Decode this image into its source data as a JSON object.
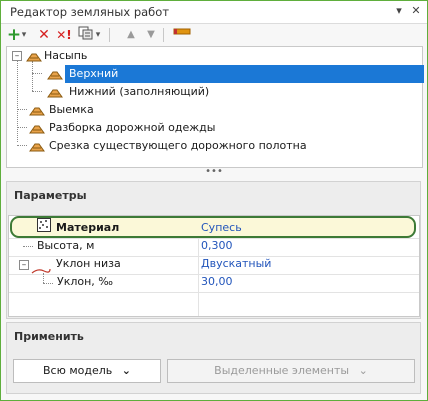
{
  "window": {
    "title": "Редактор земляных работ",
    "accent": "#5fae3c"
  },
  "titlebar": {
    "pin_glyph": "▾",
    "close_glyph": "✕"
  },
  "toolbar": {
    "add_glyph": "+",
    "dropdown_glyph": "▾",
    "delete_glyph": "✕",
    "delete_all_glyph": "✕!",
    "up_glyph": "▲",
    "down_glyph": "▼"
  },
  "tree": {
    "expander_glyph": "–",
    "items": [
      {
        "label": "Насыпь"
      },
      {
        "label": "Верхний"
      },
      {
        "label": "Нижний (заполняющий)"
      },
      {
        "label": "Выемка"
      },
      {
        "label": "Разборка дорожной одежды"
      },
      {
        "label": "Срезка существующего дорожного полотна"
      }
    ]
  },
  "splitter": {
    "glyph": "•••"
  },
  "params": {
    "header": "Параметры",
    "expander_glyph": "–",
    "rows": [
      {
        "name": "Материал",
        "value": "Супесь"
      },
      {
        "name": "Высота, м",
        "value": "0,300"
      },
      {
        "name": "Уклон низа",
        "value": "Двускатный"
      },
      {
        "name": "Уклон, ‰",
        "value": "30,00"
      }
    ]
  },
  "apply": {
    "header": "Применить",
    "all_model_label": "Всю модель",
    "selected_label": "Выделенные элементы",
    "chevron_glyph": "⌄"
  }
}
